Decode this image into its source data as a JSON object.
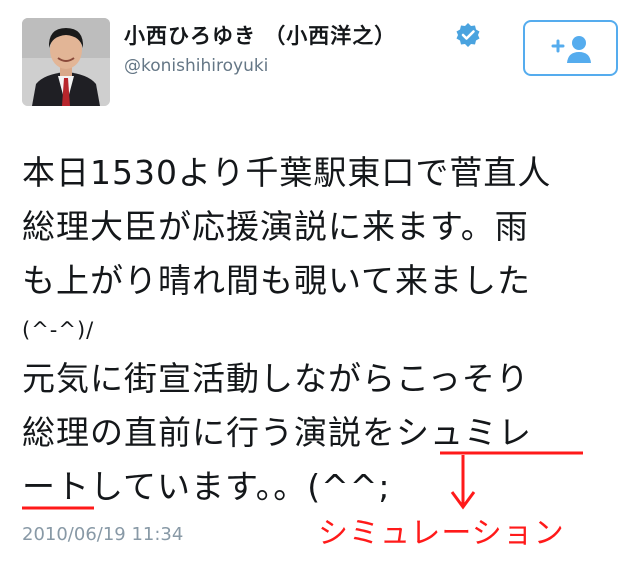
{
  "profile": {
    "display_name": "小西ひろゆき （小西洋之）",
    "handle": "@konishihiroyuki",
    "verified": true
  },
  "follow_button": {
    "icon": "follow-person-plus-icon",
    "color": "#55acee"
  },
  "tweet": {
    "lines": [
      "本日1530より千葉駅東口で菅直人",
      "総理大臣が応援演説に来ます。雨",
      "も上がり晴れ間も覗いて来ました",
      "(^-^)/",
      "元気に街宣活動しながらこっそり",
      "総理の直前に行う演説をシュミレ",
      "ートしています。。(^^;"
    ],
    "timestamp": "2010/06/19 11:34"
  },
  "annotation": {
    "label": "シミュレーション",
    "color": "#ff1a1a"
  }
}
